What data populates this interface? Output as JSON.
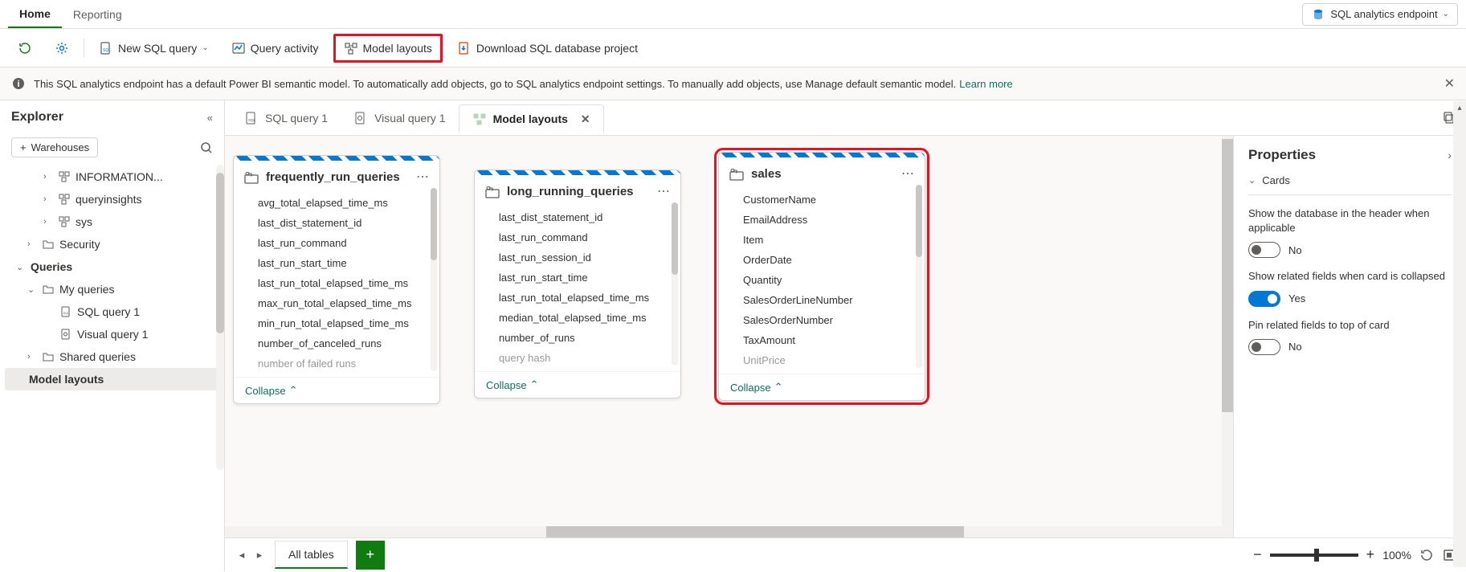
{
  "topTabs": {
    "home": "Home",
    "reporting": "Reporting"
  },
  "endpoint": "SQL analytics endpoint",
  "toolbar": {
    "newSql": "New SQL query",
    "queryActivity": "Query activity",
    "modelLayouts": "Model layouts",
    "download": "Download SQL database project"
  },
  "infoBar": {
    "text": "This SQL analytics endpoint has a default Power BI semantic model. To automatically add objects, go to SQL analytics endpoint settings. To manually add objects, use Manage default semantic model.",
    "learnMore": "Learn more"
  },
  "explorer": {
    "title": "Explorer",
    "warehouses": "Warehouses",
    "tree": {
      "information": "INFORMATION...",
      "queryinsights": "queryinsights",
      "sys": "sys",
      "security": "Security",
      "queries": "Queries",
      "myQueries": "My queries",
      "sqlQuery1": "SQL query 1",
      "visualQuery1": "Visual query 1",
      "sharedQueries": "Shared queries",
      "modelLayouts": "Model layouts"
    }
  },
  "contentTabs": {
    "sqlQuery1": "SQL query 1",
    "visualQuery1": "Visual query 1",
    "modelLayouts": "Model layouts"
  },
  "tables": {
    "frequently": {
      "name": "frequently_run_queries",
      "fields": [
        "avg_total_elapsed_time_ms",
        "last_dist_statement_id",
        "last_run_command",
        "last_run_start_time",
        "last_run_total_elapsed_time_ms",
        "max_run_total_elapsed_time_ms",
        "min_run_total_elapsed_time_ms",
        "number_of_canceled_runs",
        "number of failed runs"
      ]
    },
    "longRunning": {
      "name": "long_running_queries",
      "fields": [
        "last_dist_statement_id",
        "last_run_command",
        "last_run_session_id",
        "last_run_start_time",
        "last_run_total_elapsed_time_ms",
        "median_total_elapsed_time_ms",
        "number_of_runs",
        "query hash"
      ]
    },
    "sales": {
      "name": "sales",
      "fields": [
        "CustomerName",
        "EmailAddress",
        "Item",
        "OrderDate",
        "Quantity",
        "SalesOrderLineNumber",
        "SalesOrderNumber",
        "TaxAmount",
        "UnitPrice"
      ]
    }
  },
  "collapse": "Collapse",
  "footer": {
    "allTables": "All tables",
    "zoom": "100%"
  },
  "properties": {
    "title": "Properties",
    "cards": "Cards",
    "showDb": "Show the database in the header when applicable",
    "showRelated": "Show related fields when card is collapsed",
    "pinRelated": "Pin related fields to top of card",
    "no": "No",
    "yes": "Yes"
  }
}
